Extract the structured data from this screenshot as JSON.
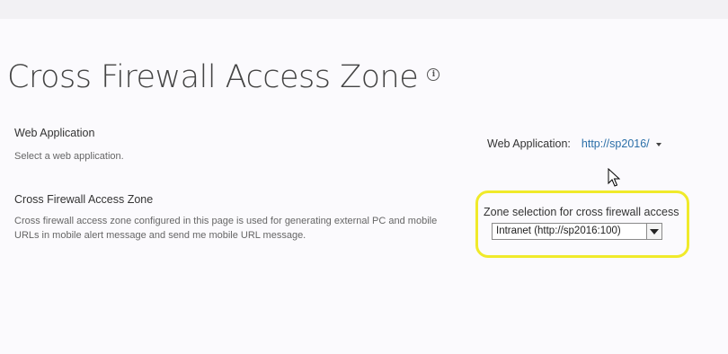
{
  "page": {
    "title": "Cross Firewall Access Zone",
    "info_icon": "info-icon"
  },
  "web_application_section": {
    "heading": "Web Application",
    "description": "Select a web application.",
    "field_label": "Web Application:",
    "selected_value": "http://sp2016/"
  },
  "zone_section": {
    "heading": "Cross Firewall Access Zone",
    "description": "Cross firewall access zone configured in this page is used for generating external PC and mobile URLs in mobile alert message and send me mobile URL message.",
    "field_label": "Zone selection for cross firewall access",
    "selected_option": "Intranet (http://sp2016:100)"
  },
  "colors": {
    "link": "#2b6fa8",
    "highlight": "#f0ea2a"
  }
}
